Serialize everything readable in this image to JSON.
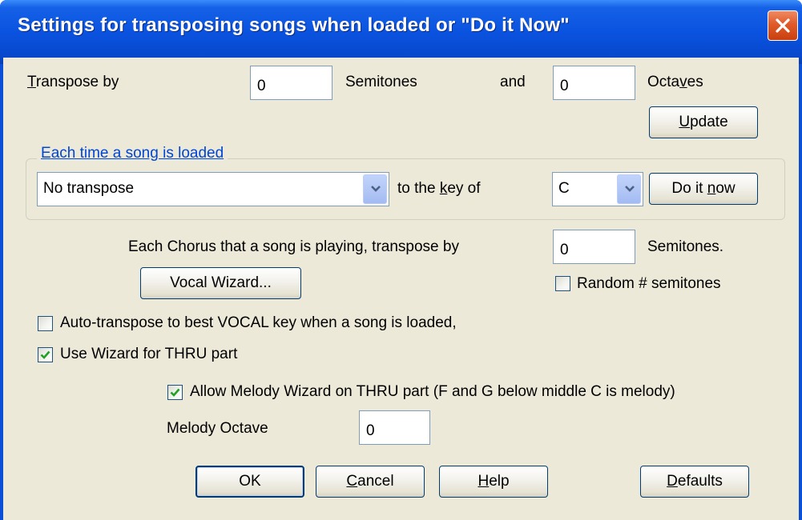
{
  "window": {
    "title": "Settings for transposing songs when loaded or \"Do it Now\""
  },
  "transpose": {
    "label_pre": "",
    "label_u": "T",
    "label_post": "ranspose by",
    "semitones_value": "0",
    "semitones_label": "Semitones",
    "and_label": "and",
    "octaves_value": "0",
    "octaves_label_pre": "Octa",
    "octaves_label_u": "v",
    "octaves_label_post": "es",
    "update_pre": "",
    "update_u": "U",
    "update_post": "pdate"
  },
  "loaded_group": {
    "legend_u": "E",
    "legend_post": "ach time a song is loaded",
    "mode_value": "No transpose",
    "to_key_pre": "to the ",
    "to_key_u": "k",
    "to_key_post": "ey of",
    "key_value": "C",
    "do_it_now_pre": "Do it ",
    "do_it_now_u": "n",
    "do_it_now_post": "ow"
  },
  "chorus": {
    "label": "Each Chorus that a song is playing, transpose by",
    "value": "0",
    "unit": "Semitones."
  },
  "vocal_wizard_label": "Vocal Wizard...",
  "random_semitones": {
    "label": "Random # semitones",
    "checked": false
  },
  "auto_transpose": {
    "label": "Auto-transpose to best VOCAL key when a song is loaded,",
    "checked": false
  },
  "use_wizard_thru": {
    "label": "Use Wizard for THRU part",
    "checked": true
  },
  "allow_melody_wizard": {
    "label": "Allow Melody Wizard on THRU part (F and G below middle C is melody)",
    "checked": true
  },
  "melody_octave": {
    "label": "Melody Octave",
    "value": "0"
  },
  "buttons": {
    "ok": "OK",
    "cancel_u": "C",
    "cancel_post": "ancel",
    "help_u": "H",
    "help_post": "elp",
    "defaults_u": "D",
    "defaults_post": "efaults"
  }
}
